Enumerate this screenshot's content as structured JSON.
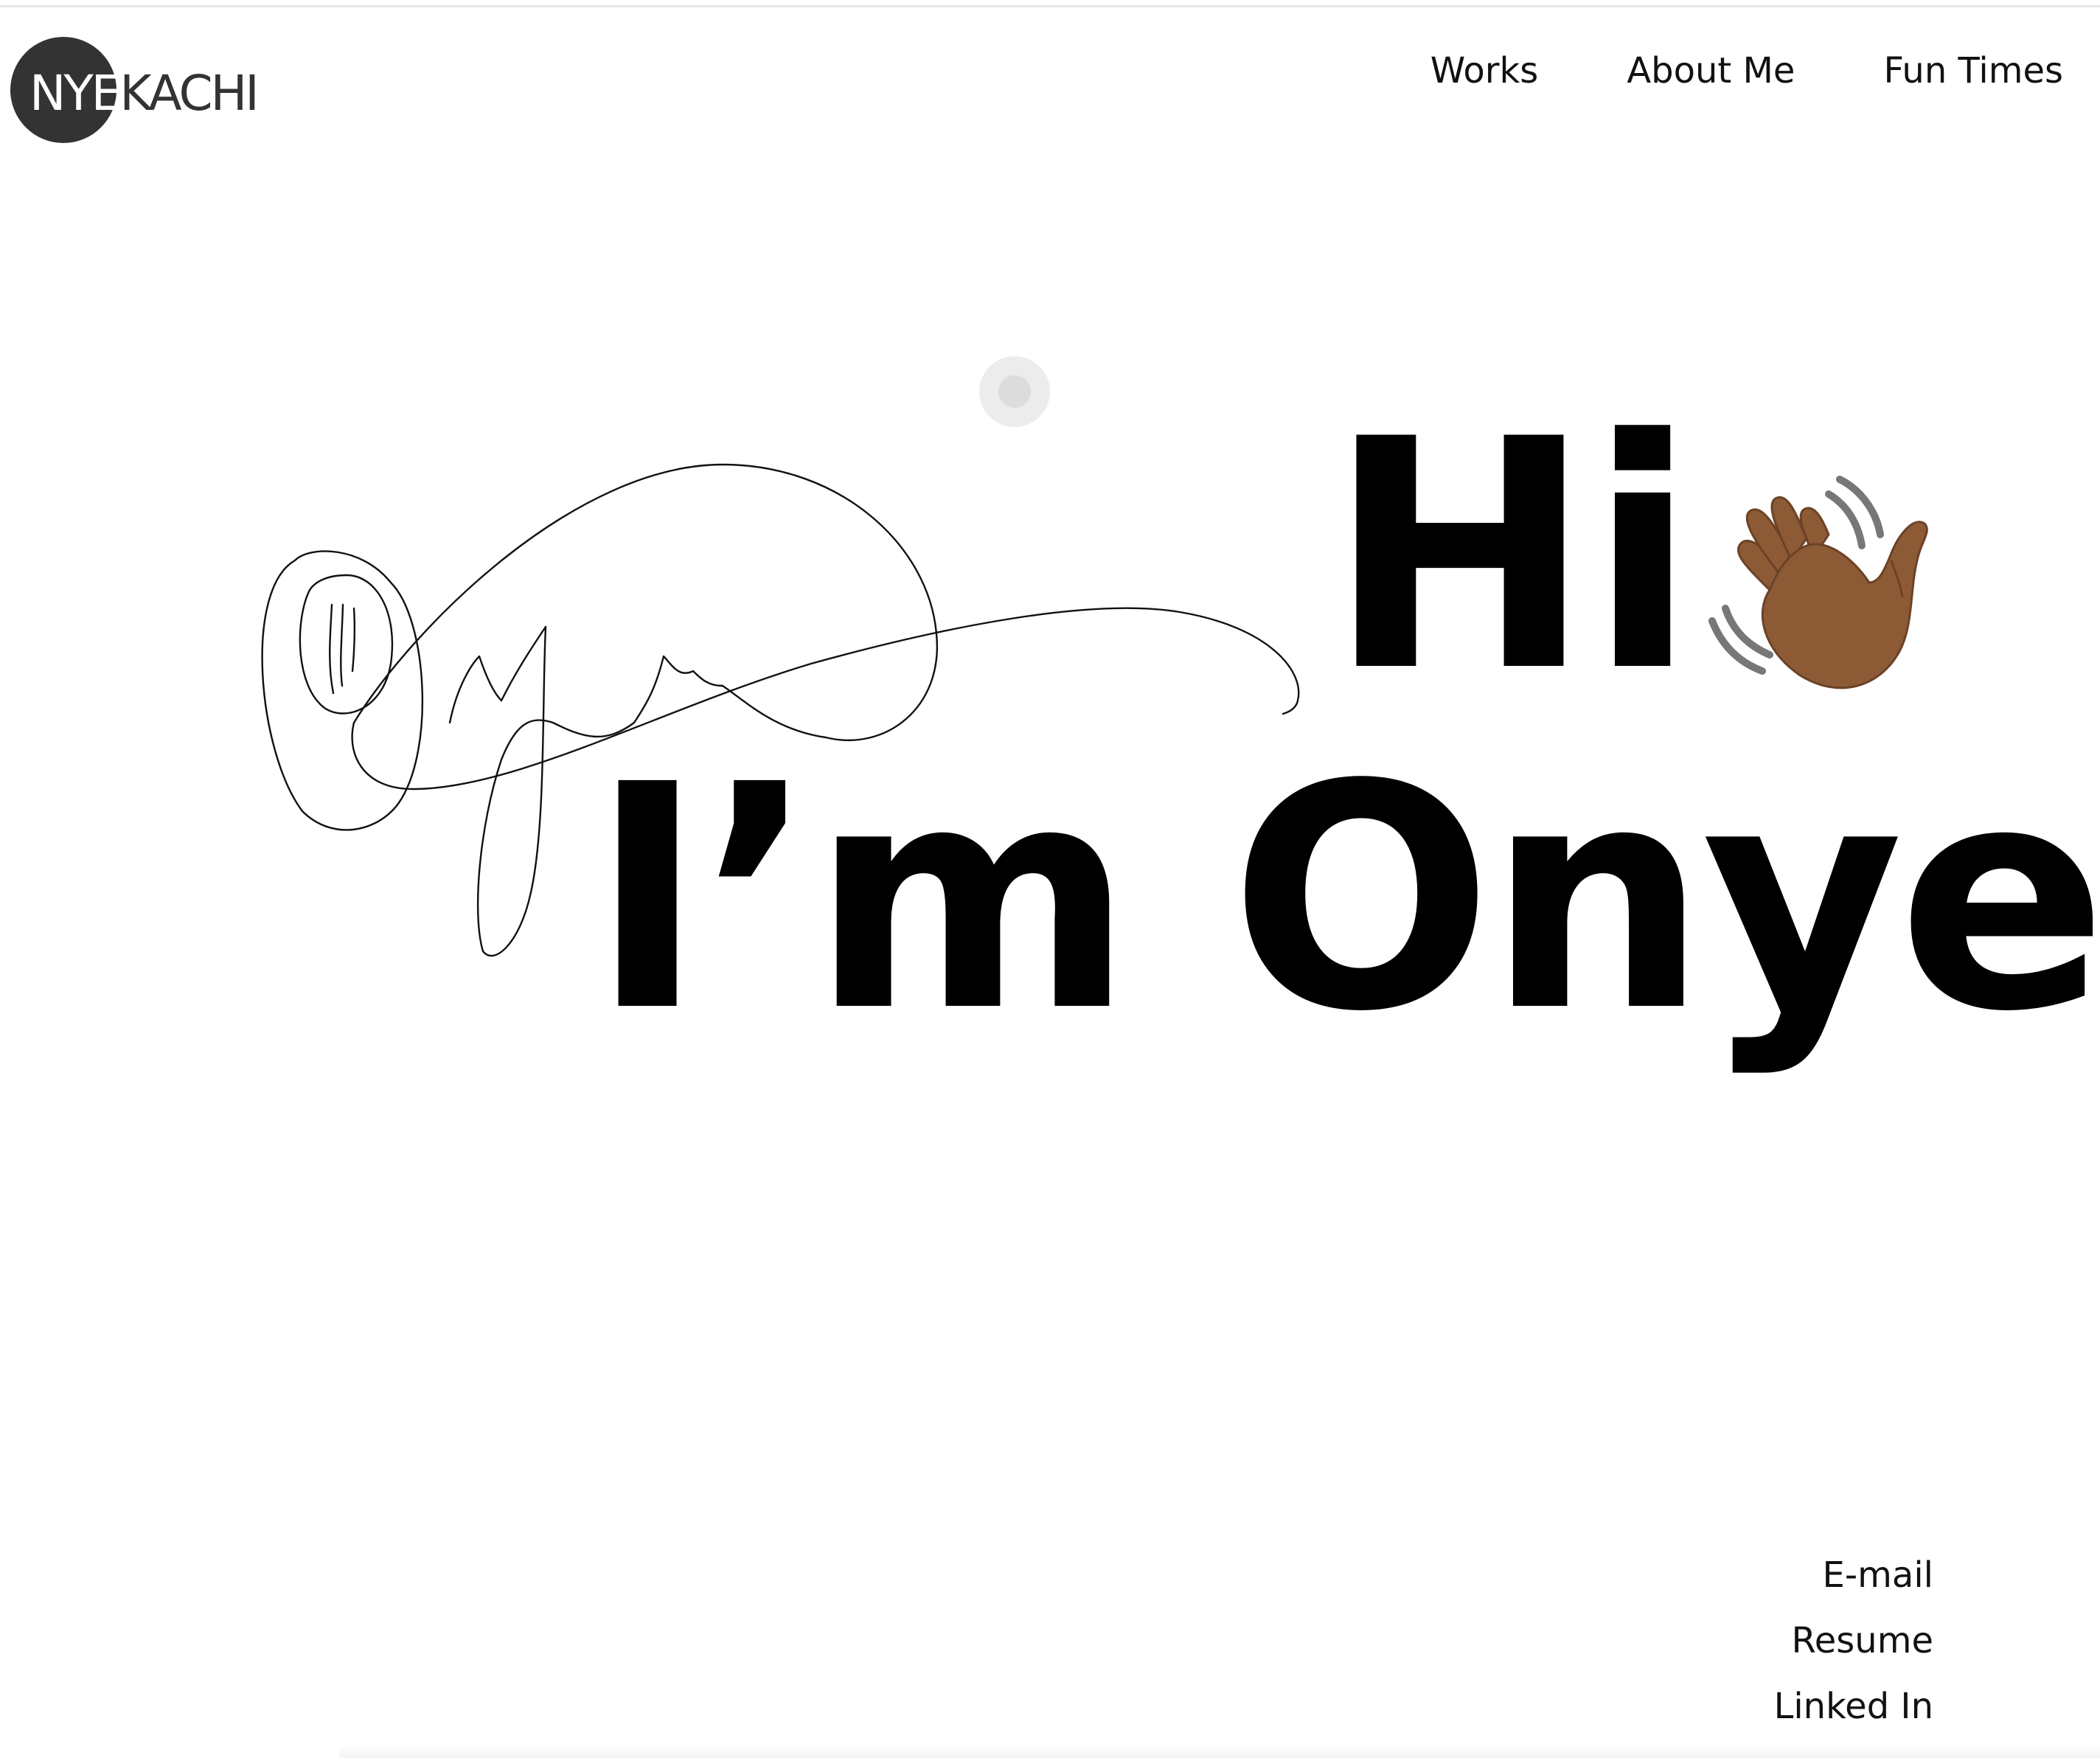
{
  "logo": {
    "text_light": "NYE",
    "text_dark_1": "KA",
    "text_dark_2": "CHI"
  },
  "nav": {
    "items": [
      "Works",
      "About Me",
      "Fun Times"
    ]
  },
  "hero": {
    "greeting": "Hi",
    "name_line": "I’m Onye",
    "wave_icon": "waving-hand-icon"
  },
  "footer": {
    "links": [
      "E-mail",
      "Resume",
      "Linked In"
    ]
  },
  "colors": {
    "logo_circle": "#333333",
    "text": "#000000",
    "background": "#ffffff",
    "wave_skin": "#8d5a36"
  }
}
